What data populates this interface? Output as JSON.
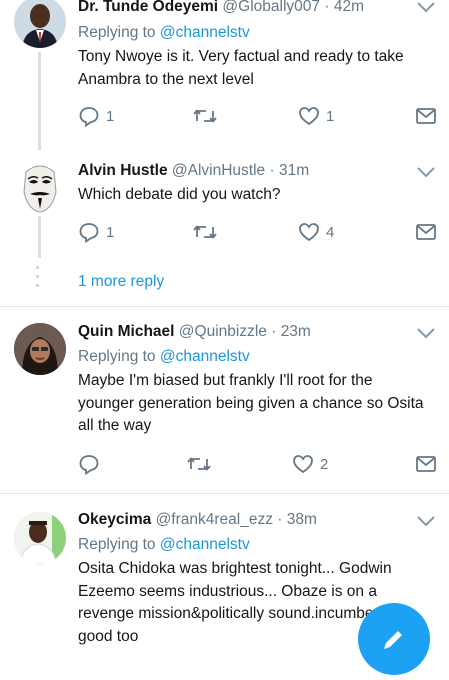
{
  "tweets": [
    {
      "name": "Dr. Tunde Odeyemi",
      "handle": "@Globally007",
      "time": "42m",
      "replying_prefix": "Replying to ",
      "replying_to": "@channelstv",
      "text": "Tony Nwoye is it. Very factual and ready to take Anambra to the next level",
      "reply_count": "1",
      "retweet_count": "",
      "like_count": "1"
    },
    {
      "name": "Alvin Hustle",
      "handle": "@AlvinHustle",
      "time": "31m",
      "text": "Which debate did you watch?",
      "reply_count": "1",
      "retweet_count": "",
      "like_count": "4"
    },
    {
      "name": "Quin Michael",
      "handle": "@Quinbizzle",
      "time": "23m",
      "replying_prefix": "Replying to ",
      "replying_to": "@channelstv",
      "text": "Maybe I'm biased but frankly I'll root for the younger generation being given a chance so Osita all the way",
      "reply_count": "",
      "retweet_count": "",
      "like_count": "2"
    },
    {
      "name": "Okeycima",
      "handle": "@frank4real_ezz",
      "time": "38m",
      "replying_prefix": "Replying to ",
      "replying_to": "@channelstv",
      "text": "Osita Chidoka was brightest tonight... Godwin Ezeemo seems industrious... Obaze is on a revenge mission&politically sound.incumbent good too"
    }
  ],
  "more_replies_label": "1 more reply",
  "dot_separator": "·",
  "icons": {
    "reply": "reply-icon",
    "retweet": "retweet-icon",
    "like": "heart-icon",
    "dm": "envelope-icon",
    "menu": "chevron-down-icon",
    "compose": "compose-icon"
  },
  "colors": {
    "accent": "#1da1f2",
    "link": "#1b95e0",
    "secondary_text": "#657786",
    "separator": "#e1e8ed"
  }
}
